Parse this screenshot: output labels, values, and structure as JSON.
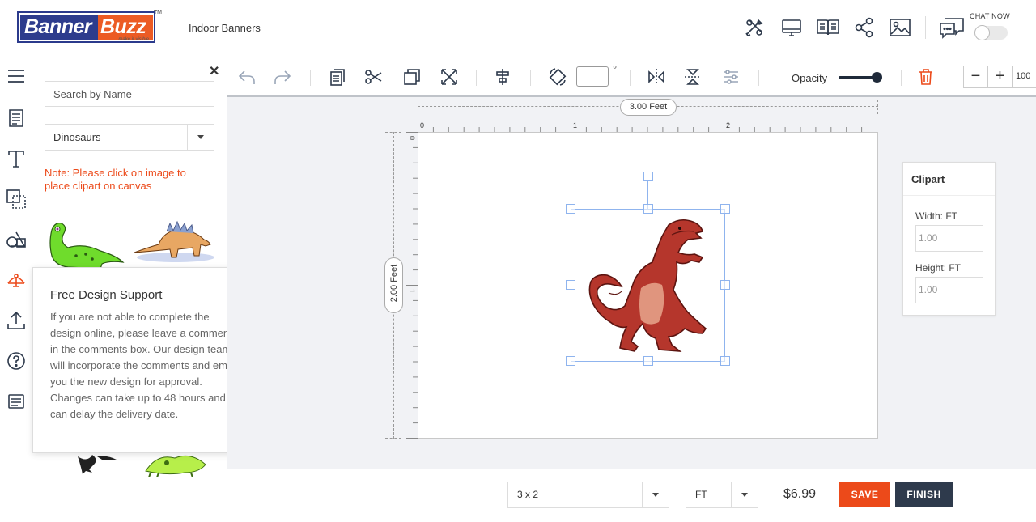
{
  "header": {
    "logo_left": "Banner",
    "logo_right": "Buzz",
    "logo_tagline": "make it visible",
    "logo_tm": "TM",
    "product_title": "Indoor Banners",
    "chat_label": "CHAT NOW"
  },
  "panel": {
    "search_placeholder": "Search by Name",
    "category": "Dinosaurs",
    "note": "Note: Please click on image to place clipart on canvas"
  },
  "support": {
    "title": "Free Design Support",
    "body": "If you are not able to complete the design online, please leave a comments in the comments box. Our design team will incorporate the comments and email you the new design for approval. Changes can take up to 48 hours and can delay the delivery date."
  },
  "toolbar": {
    "angle_value": "",
    "degree_symbol": "°",
    "opacity_label": "Opacity",
    "opacity_value": 1.0,
    "zoom_minus": "−",
    "zoom_plus": "+",
    "zoom_value": "100"
  },
  "canvas": {
    "width_label": "3.00 Feet",
    "height_label": "2.00 Feet",
    "ruler_top": [
      "0",
      "1",
      "2"
    ],
    "ruler_left": [
      "0",
      "1"
    ]
  },
  "props": {
    "title": "Clipart",
    "width_label": "Width: FT",
    "width_value": "1.00",
    "height_label": "Height: FT",
    "height_value": "1.00"
  },
  "bottom": {
    "size": "3 x 2",
    "unit": "FT",
    "price": "$6.99",
    "save": "SAVE",
    "finish": "FINISH"
  },
  "colors": {
    "accent": "#ec4a1a",
    "brand_blue": "#2d3c8d",
    "dark": "#2e3a4c",
    "selection": "#8fb4ee"
  }
}
